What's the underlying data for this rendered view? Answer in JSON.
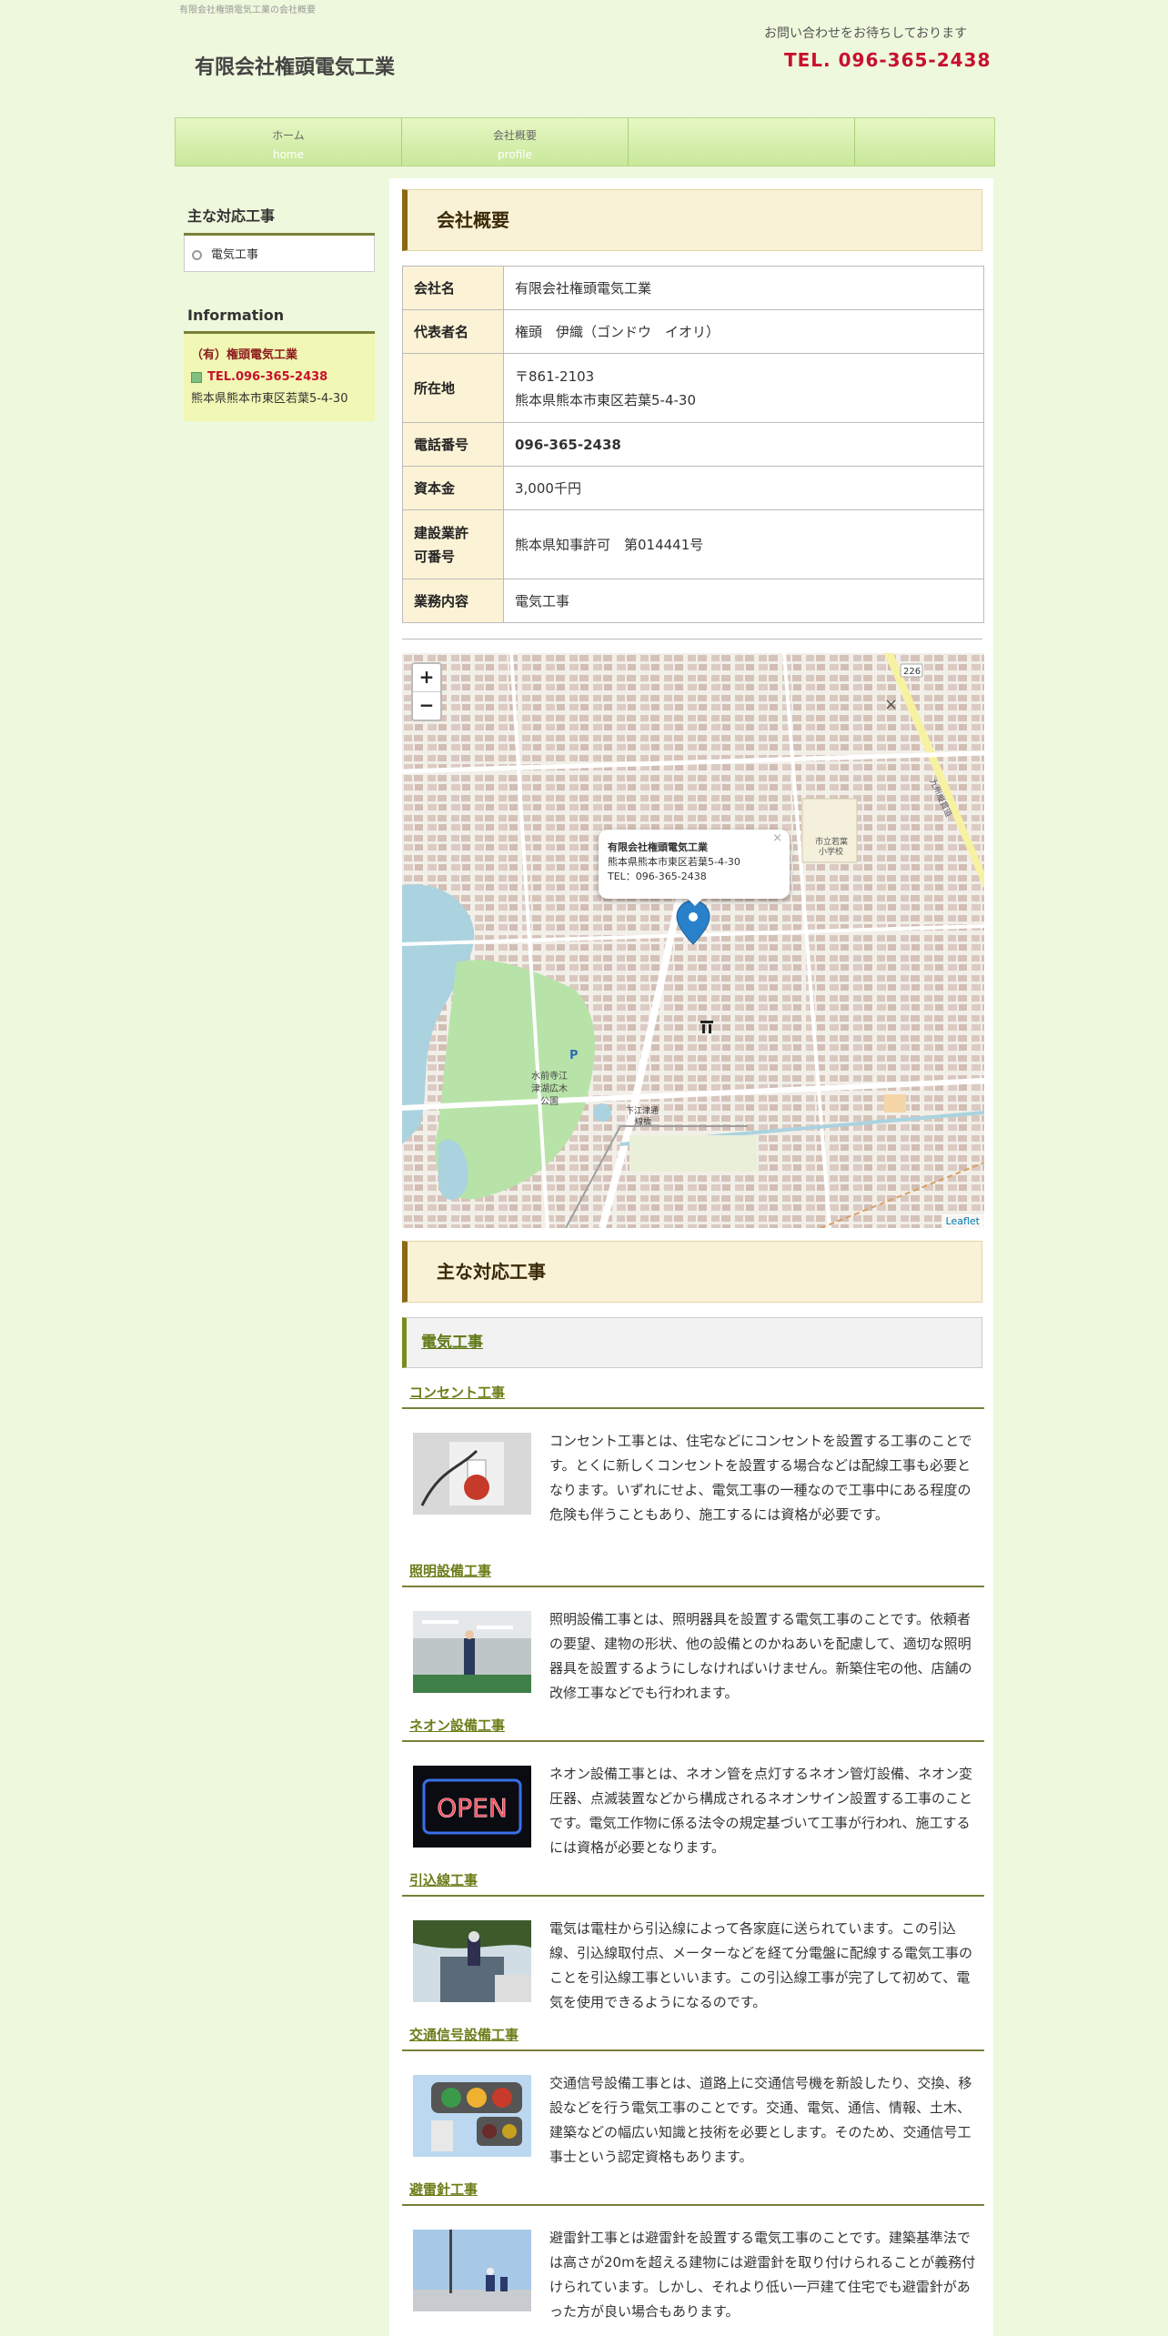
{
  "header": {
    "topline": "有限会社権頭電気工業の会社概要",
    "site_title": "有限会社権頭電気工業",
    "contact_note": "お問い合わせをお待ちしております",
    "contact_tel": "TEL. 096-365-2438"
  },
  "nav": {
    "items": [
      {
        "label": "ホーム",
        "sub": "home"
      },
      {
        "label": "会社概要",
        "sub": "profile"
      },
      {
        "label": "",
        "sub": ""
      }
    ]
  },
  "sidebar": {
    "works_heading": "主な対応工事",
    "works_item": "電気工事",
    "info_heading": "Information",
    "info_company": "（有）権頭電気工業",
    "info_tel": "TEL.096-365-2438",
    "info_address": "熊本県熊本市東区若葉5-4-30"
  },
  "main": {
    "profile_heading": "会社概要",
    "profile_rows": [
      {
        "label": "会社名",
        "value": "有限会社権頭電気工業"
      },
      {
        "label": "代表者名",
        "value": "権頭　伊織（ゴンドウ　イオリ）"
      },
      {
        "label": "所在地",
        "value1": "〒861-2103",
        "value2": "熊本県熊本市東区若葉5-4-30"
      },
      {
        "label": "電話番号",
        "value": "096-365-2438"
      },
      {
        "label": "資本金",
        "value": "3,000千円"
      },
      {
        "label1": "建設業許",
        "label2": "可番号",
        "value": "熊本県知事許可　第014441号"
      },
      {
        "label": "業務内容",
        "value": "電気工事"
      }
    ],
    "map": {
      "zoom_in": "+",
      "zoom_out": "−",
      "popup_title": "有限会社権頭電気工業",
      "popup_address": "熊本県熊本市東区若葉5-4-30",
      "popup_tel": "TEL：096-365-2438",
      "popup_close": "×",
      "close": "×",
      "attribution": "Leaflet",
      "labels": {
        "park1": "水前寺江",
        "park2": "津湖広木",
        "park3": "公園",
        "station1": "下江津通",
        "station2": "線橋",
        "school1": "市立若葉",
        "school2": "小学校",
        "route": "226",
        "road": "九州縦貫道",
        "parking": "P"
      }
    },
    "works_heading": "主な対応工事",
    "sub_heading": "電気工事",
    "works": [
      {
        "title": "コンセント工事",
        "text": "コンセント工事とは、住宅などにコンセントを設置する工事のことです。とくに新しくコンセントを設置する場合などは配線工事も必要となります。いずれにせよ、電気工事の一種なので工事中にある程度の危険も伴うこともあり、施工するには資格が必要です。"
      },
      {
        "title": "照明設備工事",
        "text": "照明設備工事とは、照明器具を設置する電気工事のことです。依頼者の要望、建物の形状、他の設備とのかねあいを配慮して、適切な照明器具を設置するようにしなければいけません。新築住宅の他、店舗の改修工事などでも行われます。"
      },
      {
        "title": "ネオン設備工事",
        "text": "ネオン設備工事とは、ネオン管を点灯するネオン管灯設備、ネオン変圧器、点滅装置などから構成されるネオンサイン設置する工事のことです。電気工作物に係る法令の規定基づいて工事が行われ、施工するには資格が必要となります。",
        "sign": "OPEN"
      },
      {
        "title": "引込線工事",
        "text": "電気は電柱から引込線によって各家庭に送られています。この引込線、引込線取付点、メーターなどを経て分電盤に配線する電気工事のことを引込線工事といいます。この引込線工事が完了して初めて、電気を使用できるようになるのです。"
      },
      {
        "title": "交通信号設備工事",
        "text": "交通信号設備工事とは、道路上に交通信号機を新設したり、交換、移設などを行う電気工事のことです。交通、電気、通信、情報、土木、建築などの幅広い知識と技術を必要とします。そのため、交通信号工事士という認定資格もあります。"
      },
      {
        "title": "避雷針工事",
        "text": "避雷針工事とは避雷針を設置する電気工事のことです。建築基準法では高さが20mを超える建物には避雷針を取り付けられることが義務付けられています。しかし、それより低い一戸建て住宅でも避雷針があった方が良い場合もあります。"
      }
    ]
  },
  "colors": {
    "background": "#eef8dc",
    "accent_red": "#c8102e",
    "heading_bg": "#faf2d6",
    "olive": "#7a7f3a"
  }
}
